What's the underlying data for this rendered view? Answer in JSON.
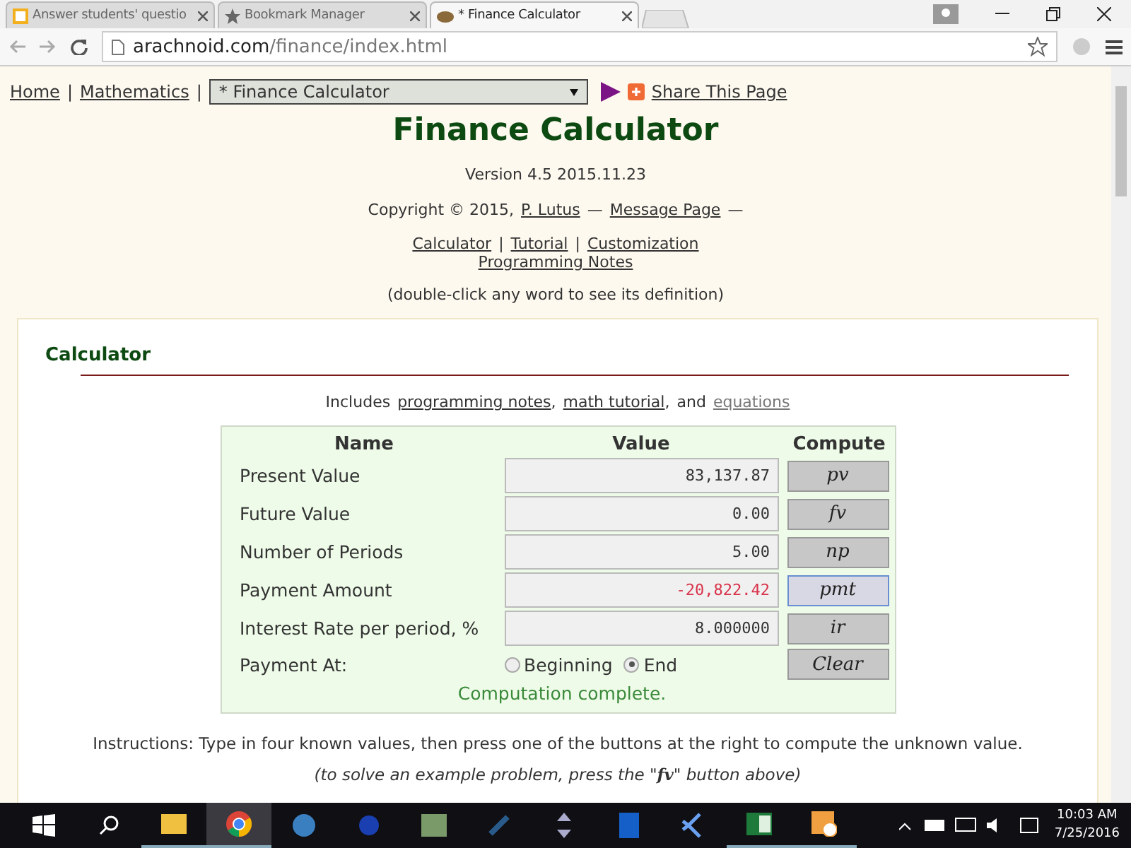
{
  "browser": {
    "tabs": [
      {
        "title": "Answer students' questio",
        "selected": false
      },
      {
        "title": "Bookmark Manager",
        "selected": false
      },
      {
        "title": "* Finance Calculator",
        "selected": true
      }
    ],
    "address": {
      "host": "arachnoid.com",
      "path": "/finance/index.html"
    }
  },
  "nav": {
    "links": [
      "Home",
      "|",
      "Mathematics",
      "|"
    ],
    "select": "* Finance Calculator",
    "share": "Share This Page"
  },
  "header": {
    "title": "Finance Calculator",
    "version": "Version 4.5 2015.11.23",
    "copyright": {
      "prefix": "Copyright © 2015,",
      "author": "P. Lutus",
      "dash1": "—",
      "message": "Message Page",
      "dash2": "—"
    },
    "links": [
      "Calculator",
      "|",
      "Tutorial",
      "|",
      "Customization"
    ],
    "extra_link": "Programming Notes",
    "hint": "(double-click any word to see its definition)"
  },
  "section": {
    "heading": "Calculator",
    "includes": {
      "prefix": "Includes",
      "links": [
        "programming notes",
        ",",
        "math tutorial",
        ","
      ],
      "and": "and",
      "last": "equations"
    },
    "table": {
      "columns": [
        "Name",
        "Value",
        "Compute"
      ],
      "rows": [
        {
          "name": "Present Value",
          "value": "83,137.87",
          "color": "#333333",
          "button": "pv",
          "focused": false
        },
        {
          "name": "Future Value",
          "value": "0.00",
          "color": "#333333",
          "button": "fv",
          "focused": false
        },
        {
          "name": "Number of Periods",
          "value": "5.00",
          "color": "#333333",
          "button": "np",
          "focused": false
        },
        {
          "name": "Payment Amount",
          "value": "-20,822.42",
          "color": "#d9324a",
          "button": "pmt",
          "focused": true
        },
        {
          "name": "Interest Rate per period, %",
          "value": "8.000000",
          "color": "#333333",
          "button": "ir",
          "focused": false
        }
      ],
      "payment_at": {
        "label": "Payment At:",
        "options": [
          {
            "label": "Beginning",
            "selected": false
          },
          {
            "label": "End",
            "selected": true
          }
        ]
      },
      "clear": "Clear",
      "status": "Computation complete."
    },
    "instructions": "Instructions: Type in four known values, then press one of the buttons at the right to compute the unknown value.",
    "example": "(to solve an example problem, press the \"**fv**\" button above)"
  },
  "taskbar": {
    "time": "10:03 AM",
    "date": "7/25/2016"
  }
}
